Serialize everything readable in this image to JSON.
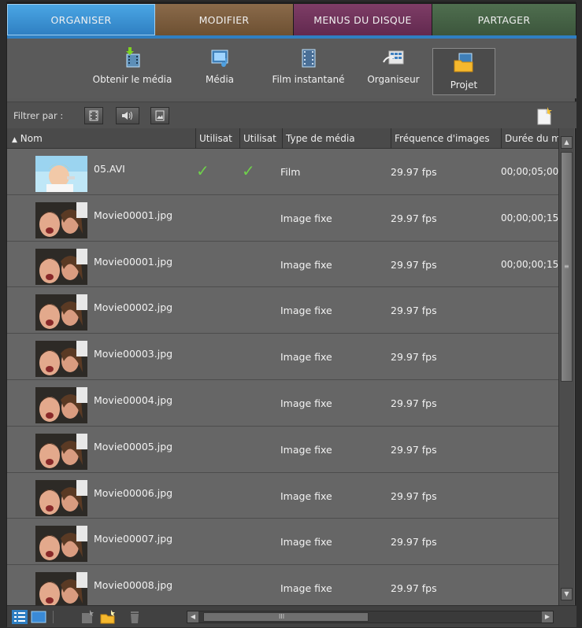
{
  "tabs": [
    {
      "label": "ORGANISER"
    },
    {
      "label": "MODIFIER"
    },
    {
      "label": "MENUS DU DISQUE"
    },
    {
      "label": "PARTAGER"
    }
  ],
  "toolbar": {
    "buttons": [
      {
        "label": "Obtenir le média",
        "icon": "get-media-icon"
      },
      {
        "label": "Média",
        "icon": "media-icon"
      },
      {
        "label": "Film instantané",
        "icon": "instant-movie-icon"
      },
      {
        "label": "Organiseur",
        "icon": "organizer-icon"
      },
      {
        "label": "Projet",
        "icon": "project-icon",
        "active": true
      }
    ]
  },
  "filter": {
    "label": "Filtrer par :",
    "buttons": [
      "video-filter-icon",
      "audio-filter-icon",
      "image-filter-icon"
    ]
  },
  "columns": {
    "name": "Nom",
    "used1": "Utilisat",
    "used2": "Utilisat",
    "type": "Type de média",
    "fps": "Fréquence d'images",
    "duration": "Durée du m"
  },
  "rows": [
    {
      "name": "05.AVI",
      "used1": "✓",
      "used2": "✓",
      "type": "Film",
      "fps": "29.97 fps",
      "duration": "00;00;05;00",
      "thumb": "video"
    },
    {
      "name": "Movie00001.jpg",
      "used1": "",
      "used2": "",
      "type": "Image fixe",
      "fps": "29.97 fps",
      "duration": "00;00;00;15",
      "thumb": "photo"
    },
    {
      "name": "Movie00001.jpg",
      "used1": "",
      "used2": "",
      "type": "Image fixe",
      "fps": "29.97 fps",
      "duration": "00;00;00;15",
      "thumb": "photo"
    },
    {
      "name": "Movie00002.jpg",
      "used1": "",
      "used2": "",
      "type": "Image fixe",
      "fps": "29.97 fps",
      "duration": "",
      "thumb": "photo"
    },
    {
      "name": "Movie00003.jpg",
      "used1": "",
      "used2": "",
      "type": "Image fixe",
      "fps": "29.97 fps",
      "duration": "",
      "thumb": "photo"
    },
    {
      "name": "Movie00004.jpg",
      "used1": "",
      "used2": "",
      "type": "Image fixe",
      "fps": "29.97 fps",
      "duration": "",
      "thumb": "photo"
    },
    {
      "name": "Movie00005.jpg",
      "used1": "",
      "used2": "",
      "type": "Image fixe",
      "fps": "29.97 fps",
      "duration": "",
      "thumb": "photo"
    },
    {
      "name": "Movie00006.jpg",
      "used1": "",
      "used2": "",
      "type": "Image fixe",
      "fps": "29.97 fps",
      "duration": "",
      "thumb": "photo"
    },
    {
      "name": "Movie00007.jpg",
      "used1": "",
      "used2": "",
      "type": "Image fixe",
      "fps": "29.97 fps",
      "duration": "",
      "thumb": "photo"
    },
    {
      "name": "Movie00008.jpg",
      "used1": "",
      "used2": "",
      "type": "Image fixe",
      "fps": "29.97 fps",
      "duration": "",
      "thumb": "photo"
    }
  ],
  "scroll": {
    "hgrip": "III"
  },
  "bottom": {
    "icons": [
      "list-view-icon",
      "icon-view-icon",
      "new-item-icon",
      "new-folder-icon",
      "delete-icon"
    ]
  },
  "colors": {
    "accent": "#2f7fc2",
    "check": "#6fd04b",
    "panel": "#595959"
  }
}
